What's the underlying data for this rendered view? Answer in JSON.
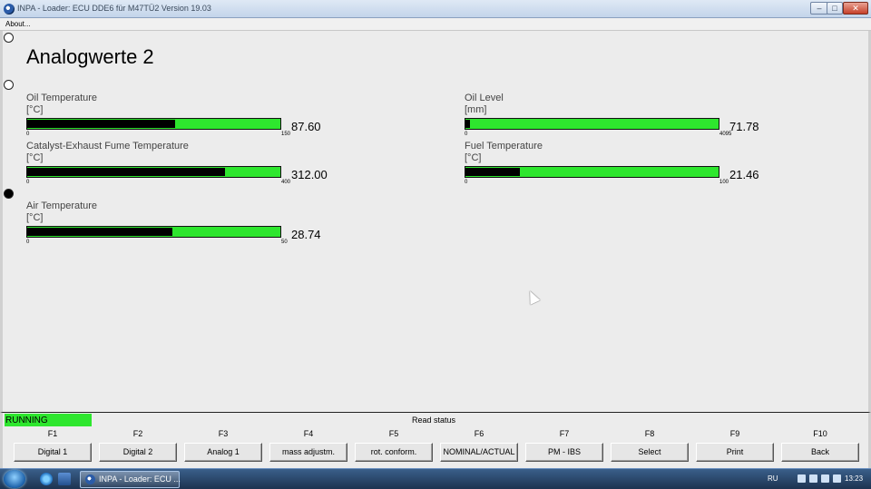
{
  "window": {
    "title": "INPA - Loader:  ECU DDE6 für M47TÜ2 Version 19.03",
    "buttons": {
      "minimize": "–",
      "maximize": "□",
      "close": "✕"
    }
  },
  "menu": {
    "about": "About..."
  },
  "page": {
    "title": "Analogwerte 2"
  },
  "gauges": [
    {
      "label": "Oil Temperature",
      "unit": "[°C]",
      "value": "87.60",
      "min": "0",
      "max": "150",
      "level": 0.584
    },
    {
      "label": "Catalyst-Exhaust Fume Temperature",
      "unit": "[°C]",
      "value": "312.00",
      "min": "0",
      "max": "400",
      "level": 0.78
    },
    {
      "label": "Air Temperature",
      "unit": "[°C]",
      "value": "28.74",
      "min": "0",
      "max": "50",
      "level": 0.575
    },
    {
      "label": "Oil Level",
      "unit": "[mm]",
      "value": "71.78",
      "min": "0",
      "max": "4095",
      "level": 0.0175
    },
    {
      "label": "Fuel Temperature",
      "unit": "[°C]",
      "value": "21.46",
      "min": "0",
      "max": "100",
      "level": 0.215
    }
  ],
  "status": {
    "running": "RUNNING",
    "read_status": "Read status"
  },
  "fkeys": [
    {
      "key": "F1",
      "label": "Digital 1"
    },
    {
      "key": "F2",
      "label": "Digital 2"
    },
    {
      "key": "F3",
      "label": "Analog 1"
    },
    {
      "key": "F4",
      "label": "mass adjustm."
    },
    {
      "key": "F5",
      "label": "rot. conform."
    },
    {
      "key": "F6",
      "label": "NOMINAL/ACTUAL"
    },
    {
      "key": "F7",
      "label": "PM - IBS"
    },
    {
      "key": "F8",
      "label": "Select"
    },
    {
      "key": "F9",
      "label": "Print"
    },
    {
      "key": "F10",
      "label": "Back"
    }
  ],
  "taskbar": {
    "task_label": "INPA - Loader:  ECU ...",
    "language": "RU",
    "clock": "13:23"
  },
  "colors": {
    "bar_green": "#2ee62e",
    "running_green": "#2ee62e"
  }
}
